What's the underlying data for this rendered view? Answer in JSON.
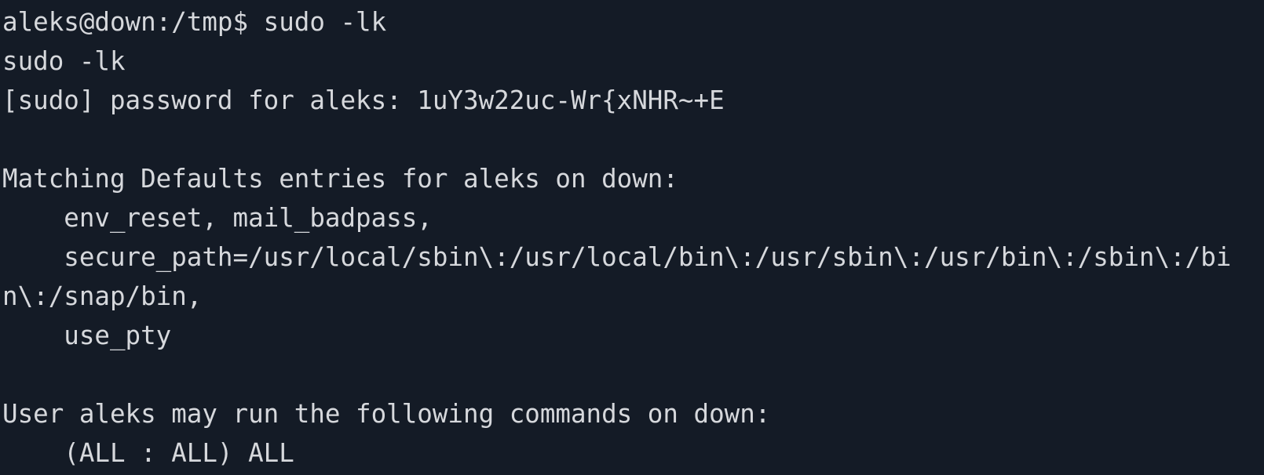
{
  "terminal": {
    "background_color": "#141b26",
    "text_color": "#d6d8dc",
    "lines": [
      "aleks@down:/tmp$ sudo -lk",
      "sudo -lk",
      "[sudo] password for aleks: 1uY3w22uc-Wr{xNHR~+E",
      "",
      "Matching Defaults entries for aleks on down:",
      "    env_reset, mail_badpass,",
      "    secure_path=/usr/local/sbin\\:/usr/local/bin\\:/usr/sbin\\:/usr/bin\\:/sbin\\:/bi",
      "n\\:/snap/bin,",
      "    use_pty",
      "",
      "User aleks may run the following commands on down:",
      "    (ALL : ALL) ALL"
    ]
  }
}
